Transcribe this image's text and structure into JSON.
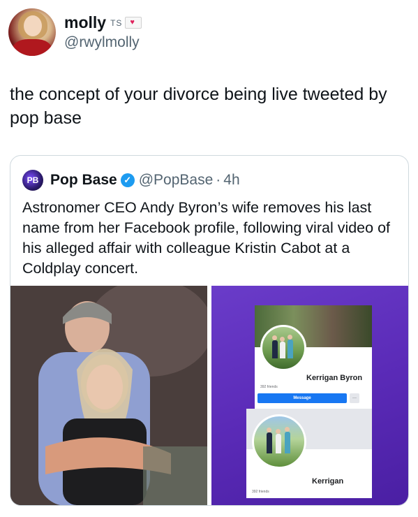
{
  "author": {
    "name": "molly",
    "badge_text": "TS",
    "badge_icon": "envelope-heart-icon",
    "handle": "@rwylmolly"
  },
  "tweet": {
    "text": "the concept of your divorce being live tweeted by pop base"
  },
  "quoted_tweet": {
    "avatar_initials": "PB",
    "name": "Pop Base",
    "verified": true,
    "handle": "@PopBase",
    "separator": "·",
    "time": "4h",
    "text": "Astronomer CEO Andy Byron’s wife removes his last name from her Facebook profile, following viral video of his alleged affair with colleague Kristin Cabot at a Coldplay concert.",
    "media": {
      "left_image": "concert-photo",
      "right_image": {
        "before": {
          "profile_name": "Kerrigan Byron",
          "friends": "392 friends",
          "message_button": "Message",
          "more_button": "···"
        },
        "after": {
          "profile_name": "Kerrigan",
          "friends": "392 friends"
        }
      }
    }
  },
  "colors": {
    "text": "#0f1419",
    "secondary": "#536471",
    "verified": "#1d9bf0",
    "facebook_blue": "#1877f2",
    "purple_bg": "#5b2bb8"
  }
}
